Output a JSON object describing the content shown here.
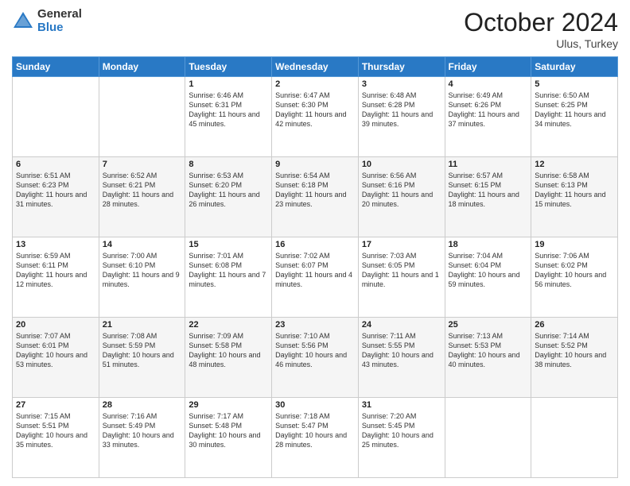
{
  "header": {
    "logo_general": "General",
    "logo_blue": "Blue",
    "month": "October 2024",
    "location": "Ulus, Turkey"
  },
  "days_of_week": [
    "Sunday",
    "Monday",
    "Tuesday",
    "Wednesday",
    "Thursday",
    "Friday",
    "Saturday"
  ],
  "weeks": [
    [
      {
        "day": "",
        "sunrise": "",
        "sunset": "",
        "daylight": ""
      },
      {
        "day": "",
        "sunrise": "",
        "sunset": "",
        "daylight": ""
      },
      {
        "day": "1",
        "sunrise": "Sunrise: 6:46 AM",
        "sunset": "Sunset: 6:31 PM",
        "daylight": "Daylight: 11 hours and 45 minutes."
      },
      {
        "day": "2",
        "sunrise": "Sunrise: 6:47 AM",
        "sunset": "Sunset: 6:30 PM",
        "daylight": "Daylight: 11 hours and 42 minutes."
      },
      {
        "day": "3",
        "sunrise": "Sunrise: 6:48 AM",
        "sunset": "Sunset: 6:28 PM",
        "daylight": "Daylight: 11 hours and 39 minutes."
      },
      {
        "day": "4",
        "sunrise": "Sunrise: 6:49 AM",
        "sunset": "Sunset: 6:26 PM",
        "daylight": "Daylight: 11 hours and 37 minutes."
      },
      {
        "day": "5",
        "sunrise": "Sunrise: 6:50 AM",
        "sunset": "Sunset: 6:25 PM",
        "daylight": "Daylight: 11 hours and 34 minutes."
      }
    ],
    [
      {
        "day": "6",
        "sunrise": "Sunrise: 6:51 AM",
        "sunset": "Sunset: 6:23 PM",
        "daylight": "Daylight: 11 hours and 31 minutes."
      },
      {
        "day": "7",
        "sunrise": "Sunrise: 6:52 AM",
        "sunset": "Sunset: 6:21 PM",
        "daylight": "Daylight: 11 hours and 28 minutes."
      },
      {
        "day": "8",
        "sunrise": "Sunrise: 6:53 AM",
        "sunset": "Sunset: 6:20 PM",
        "daylight": "Daylight: 11 hours and 26 minutes."
      },
      {
        "day": "9",
        "sunrise": "Sunrise: 6:54 AM",
        "sunset": "Sunset: 6:18 PM",
        "daylight": "Daylight: 11 hours and 23 minutes."
      },
      {
        "day": "10",
        "sunrise": "Sunrise: 6:56 AM",
        "sunset": "Sunset: 6:16 PM",
        "daylight": "Daylight: 11 hours and 20 minutes."
      },
      {
        "day": "11",
        "sunrise": "Sunrise: 6:57 AM",
        "sunset": "Sunset: 6:15 PM",
        "daylight": "Daylight: 11 hours and 18 minutes."
      },
      {
        "day": "12",
        "sunrise": "Sunrise: 6:58 AM",
        "sunset": "Sunset: 6:13 PM",
        "daylight": "Daylight: 11 hours and 15 minutes."
      }
    ],
    [
      {
        "day": "13",
        "sunrise": "Sunrise: 6:59 AM",
        "sunset": "Sunset: 6:11 PM",
        "daylight": "Daylight: 11 hours and 12 minutes."
      },
      {
        "day": "14",
        "sunrise": "Sunrise: 7:00 AM",
        "sunset": "Sunset: 6:10 PM",
        "daylight": "Daylight: 11 hours and 9 minutes."
      },
      {
        "day": "15",
        "sunrise": "Sunrise: 7:01 AM",
        "sunset": "Sunset: 6:08 PM",
        "daylight": "Daylight: 11 hours and 7 minutes."
      },
      {
        "day": "16",
        "sunrise": "Sunrise: 7:02 AM",
        "sunset": "Sunset: 6:07 PM",
        "daylight": "Daylight: 11 hours and 4 minutes."
      },
      {
        "day": "17",
        "sunrise": "Sunrise: 7:03 AM",
        "sunset": "Sunset: 6:05 PM",
        "daylight": "Daylight: 11 hours and 1 minute."
      },
      {
        "day": "18",
        "sunrise": "Sunrise: 7:04 AM",
        "sunset": "Sunset: 6:04 PM",
        "daylight": "Daylight: 10 hours and 59 minutes."
      },
      {
        "day": "19",
        "sunrise": "Sunrise: 7:06 AM",
        "sunset": "Sunset: 6:02 PM",
        "daylight": "Daylight: 10 hours and 56 minutes."
      }
    ],
    [
      {
        "day": "20",
        "sunrise": "Sunrise: 7:07 AM",
        "sunset": "Sunset: 6:01 PM",
        "daylight": "Daylight: 10 hours and 53 minutes."
      },
      {
        "day": "21",
        "sunrise": "Sunrise: 7:08 AM",
        "sunset": "Sunset: 5:59 PM",
        "daylight": "Daylight: 10 hours and 51 minutes."
      },
      {
        "day": "22",
        "sunrise": "Sunrise: 7:09 AM",
        "sunset": "Sunset: 5:58 PM",
        "daylight": "Daylight: 10 hours and 48 minutes."
      },
      {
        "day": "23",
        "sunrise": "Sunrise: 7:10 AM",
        "sunset": "Sunset: 5:56 PM",
        "daylight": "Daylight: 10 hours and 46 minutes."
      },
      {
        "day": "24",
        "sunrise": "Sunrise: 7:11 AM",
        "sunset": "Sunset: 5:55 PM",
        "daylight": "Daylight: 10 hours and 43 minutes."
      },
      {
        "day": "25",
        "sunrise": "Sunrise: 7:13 AM",
        "sunset": "Sunset: 5:53 PM",
        "daylight": "Daylight: 10 hours and 40 minutes."
      },
      {
        "day": "26",
        "sunrise": "Sunrise: 7:14 AM",
        "sunset": "Sunset: 5:52 PM",
        "daylight": "Daylight: 10 hours and 38 minutes."
      }
    ],
    [
      {
        "day": "27",
        "sunrise": "Sunrise: 7:15 AM",
        "sunset": "Sunset: 5:51 PM",
        "daylight": "Daylight: 10 hours and 35 minutes."
      },
      {
        "day": "28",
        "sunrise": "Sunrise: 7:16 AM",
        "sunset": "Sunset: 5:49 PM",
        "daylight": "Daylight: 10 hours and 33 minutes."
      },
      {
        "day": "29",
        "sunrise": "Sunrise: 7:17 AM",
        "sunset": "Sunset: 5:48 PM",
        "daylight": "Daylight: 10 hours and 30 minutes."
      },
      {
        "day": "30",
        "sunrise": "Sunrise: 7:18 AM",
        "sunset": "Sunset: 5:47 PM",
        "daylight": "Daylight: 10 hours and 28 minutes."
      },
      {
        "day": "31",
        "sunrise": "Sunrise: 7:20 AM",
        "sunset": "Sunset: 5:45 PM",
        "daylight": "Daylight: 10 hours and 25 minutes."
      },
      {
        "day": "",
        "sunrise": "",
        "sunset": "",
        "daylight": ""
      },
      {
        "day": "",
        "sunrise": "",
        "sunset": "",
        "daylight": ""
      }
    ]
  ]
}
